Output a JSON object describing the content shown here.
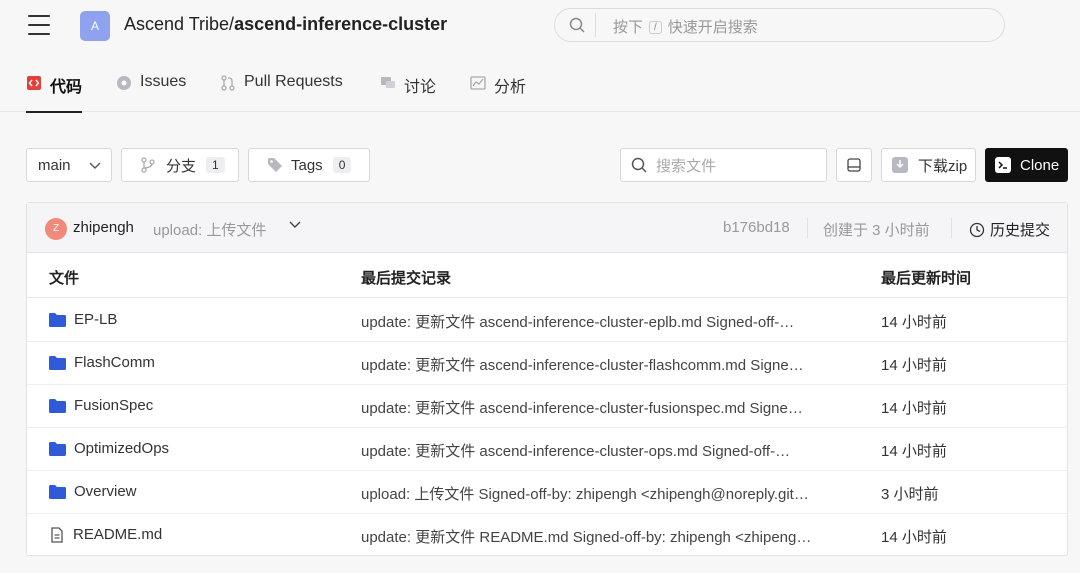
{
  "header": {
    "avatar_letter": "A",
    "owner": "Ascend Tribe/",
    "repo": "ascend-inference-cluster",
    "search_prefix": "按下",
    "search_key": "/",
    "search_suffix": "快速开启搜索"
  },
  "tabs": [
    {
      "label": "代码",
      "icon": "code-icon"
    },
    {
      "label": "Issues",
      "icon": "issue-icon"
    },
    {
      "label": "Pull Requests",
      "icon": "pull-request-icon"
    },
    {
      "label": "讨论",
      "icon": "discussion-icon"
    },
    {
      "label": "分析",
      "icon": "analytics-icon"
    }
  ],
  "toolbar": {
    "branch": "main",
    "branches_label": "分支",
    "branches_count": "1",
    "tags_label": "Tags",
    "tags_count": "0",
    "file_search_placeholder": "搜索文件",
    "download_label": "下载zip",
    "clone_label": "Clone"
  },
  "commit": {
    "avatar_letter": "Z",
    "user": "zhipengh",
    "message": "upload: 上传文件",
    "hash": "b176bd18",
    "created": "创建于 3 小时前",
    "history_label": "历史提交"
  },
  "table": {
    "columns": [
      "文件",
      "最后提交记录",
      "最后更新时间"
    ],
    "rows": [
      {
        "name": "EP-LB",
        "type": "folder",
        "message": "update: 更新文件 ascend-inference-cluster-eplb.md Signed-off-…",
        "time": "14 小时前"
      },
      {
        "name": "FlashComm",
        "type": "folder",
        "message": "update: 更新文件 ascend-inference-cluster-flashcomm.md Signe…",
        "time": "14 小时前"
      },
      {
        "name": "FusionSpec",
        "type": "folder",
        "message": "update: 更新文件 ascend-inference-cluster-fusionspec.md Signe…",
        "time": "14 小时前"
      },
      {
        "name": "OptimizedOps",
        "type": "folder",
        "message": "update: 更新文件 ascend-inference-cluster-ops.md Signed-off-…",
        "time": "14 小时前"
      },
      {
        "name": "Overview",
        "type": "folder",
        "message": "upload: 上传文件 Signed-off-by: zhipengh <zhipengh@noreply.git…",
        "time": "3 小时前"
      },
      {
        "name": "README.md",
        "type": "file",
        "message": "update: 更新文件 README.md Signed-off-by: zhipengh <zhipeng…",
        "time": "14 小时前"
      }
    ]
  },
  "colors": {
    "folder": "#2f5bd8",
    "active_tab_icon": "#e0413a",
    "clone_bg": "#111111"
  }
}
